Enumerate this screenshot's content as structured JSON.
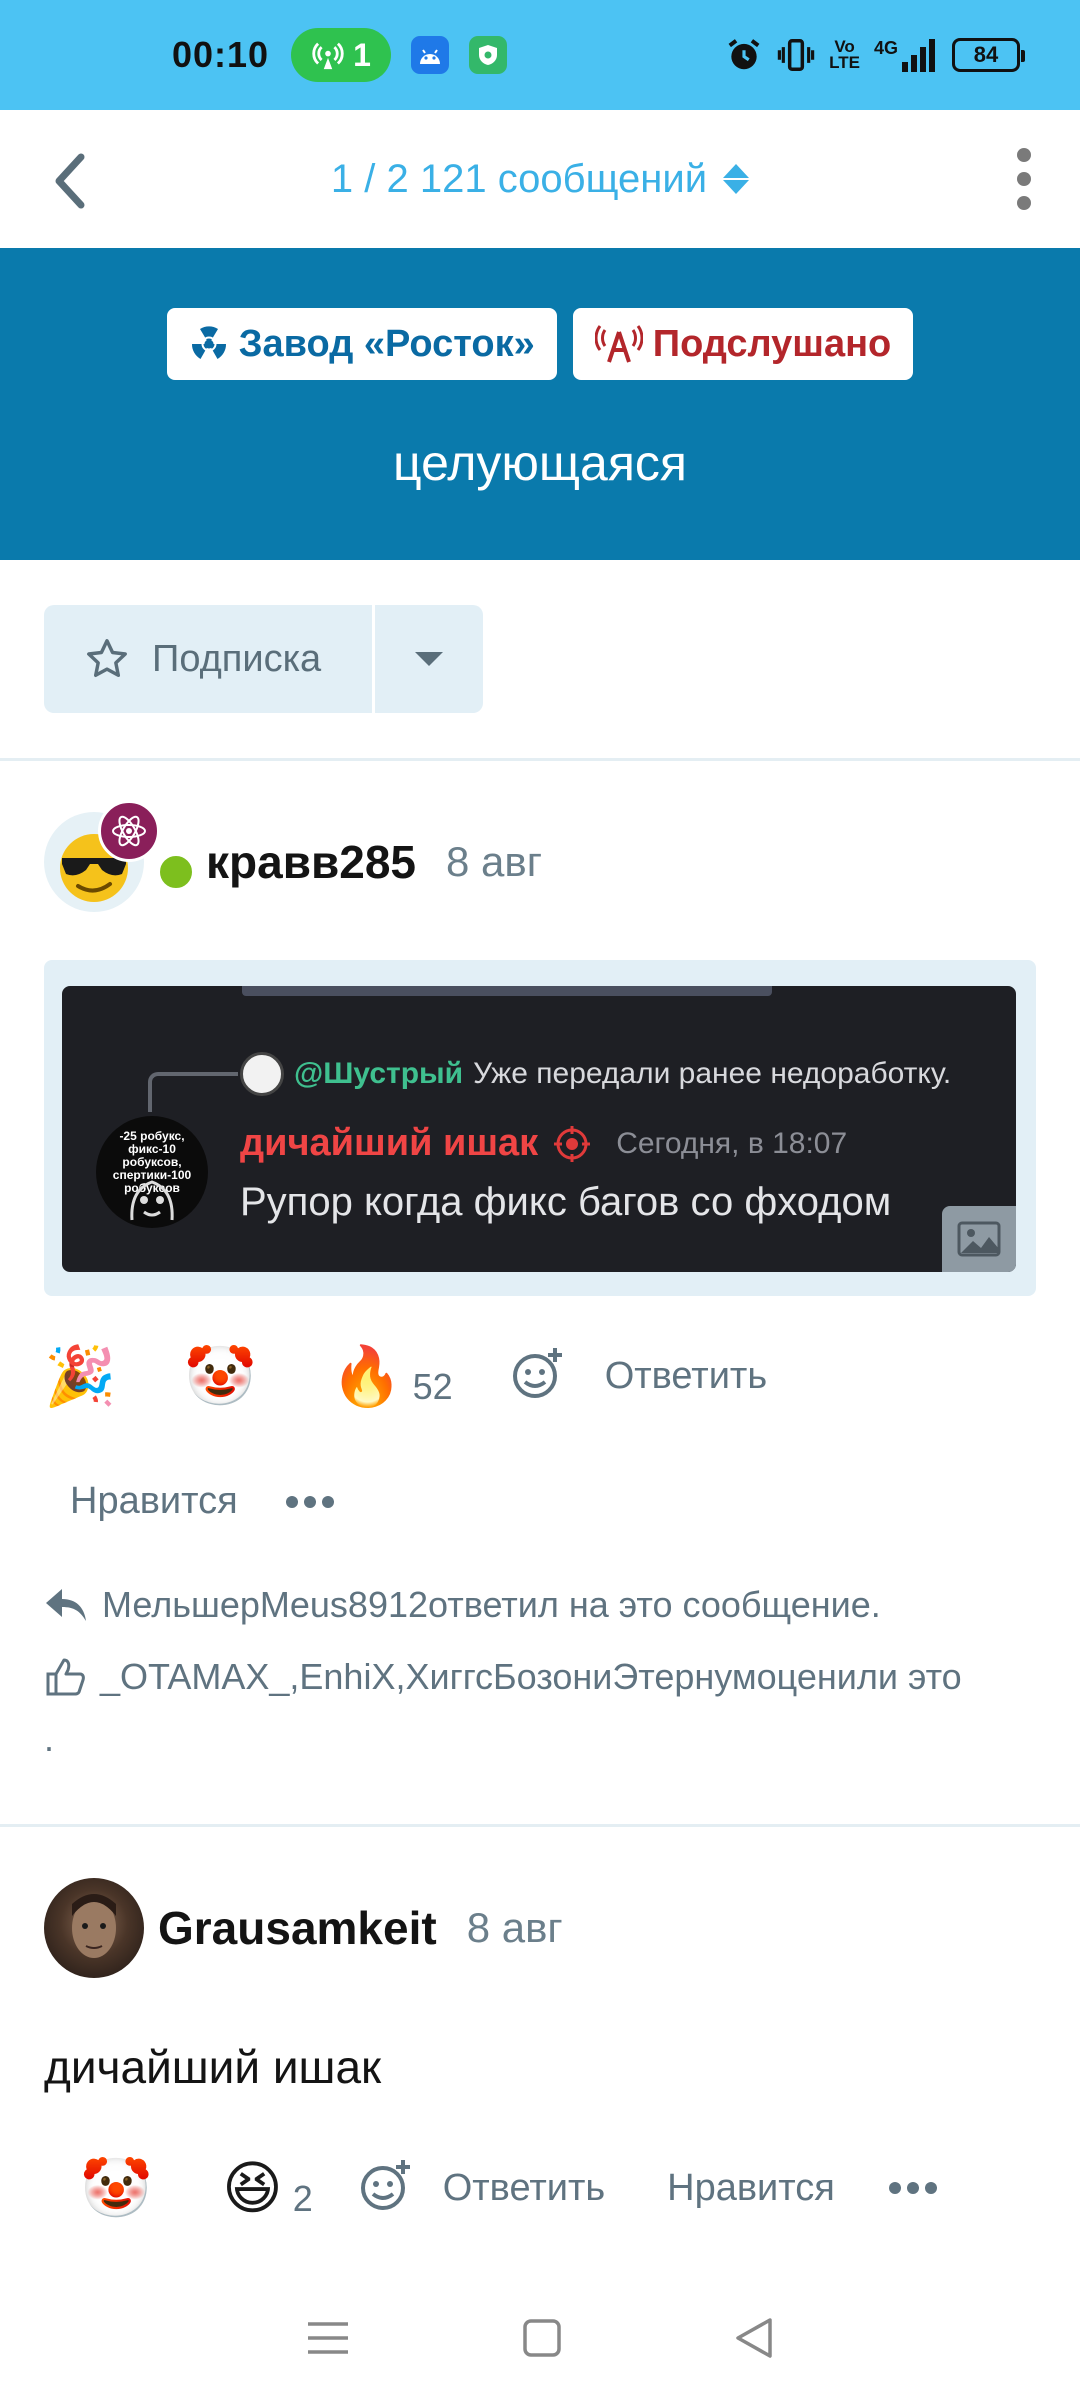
{
  "status_bar": {
    "time": "00:10",
    "hotspot_count": "1",
    "volte_top": "Vo",
    "volte_bottom": "LTE",
    "network": "4G",
    "battery": "84",
    "icons": [
      "hotspot-icon",
      "android-icon",
      "shield-icon",
      "alarm-icon",
      "vibrate-icon",
      "signal-icon",
      "battery-icon"
    ]
  },
  "app_bar": {
    "pager": "1 / 2 121 сообщений",
    "icons": [
      "back-icon",
      "sort-arrows-icon",
      "more-vert-icon"
    ]
  },
  "thread": {
    "tags": [
      {
        "label": "Завод «Росток»",
        "icon": "radiation-icon",
        "color": "#0a6aa3"
      },
      {
        "label": "Подслушано",
        "icon": "broadcast-icon",
        "color": "#b3262b"
      }
    ],
    "title": "целующаяся",
    "header_color": "#0a7aac"
  },
  "watch": {
    "label": "Подписка",
    "icons": [
      "star-icon",
      "caret-down-icon"
    ]
  },
  "posts": [
    {
      "author": "кравв285",
      "date": "8 авг",
      "online": true,
      "quote_screenshot": {
        "reply_mention": "@Шустрый",
        "reply_text": "Уже передали ранее недоработку.",
        "author_name": "дичайший ишак",
        "timestamp": "Сегодня, в 18:07",
        "message": "Рупор когда фикс багов со фходом",
        "avatar_text": "-25 робукс, фикс-10 робуксов, спертики-100 робуксов"
      },
      "reactions": [
        {
          "emoji": "🎉",
          "name": "party-emoji",
          "count": ""
        },
        {
          "emoji": "🤡",
          "name": "clown-emoji",
          "count": ""
        },
        {
          "emoji": "🔥",
          "name": "fire-emoji",
          "count": "52"
        }
      ],
      "reply_label": "Ответить",
      "like_label": "Нравится",
      "replied_info": "МельшерMeus8912ответил на это сообщение.",
      "liked_info": "_OTAMAX_,EnhiX,ХиггсБозониЭтернумоценили это",
      "liked_info_end": "."
    },
    {
      "author": "Grausamkeit",
      "date": "8 авг",
      "body": "дичайший ишак",
      "reactions": [
        {
          "emoji": "🤡",
          "name": "clown-emoji",
          "count": ""
        },
        {
          "emoji": "😆",
          "name": "laughing-emoji",
          "count": "2"
        }
      ],
      "reply_label": "Ответить",
      "like_label": "Нравится"
    }
  ],
  "nav_bar": {
    "icons": [
      "menu-icon",
      "home-square-icon",
      "back-triangle-icon"
    ]
  }
}
